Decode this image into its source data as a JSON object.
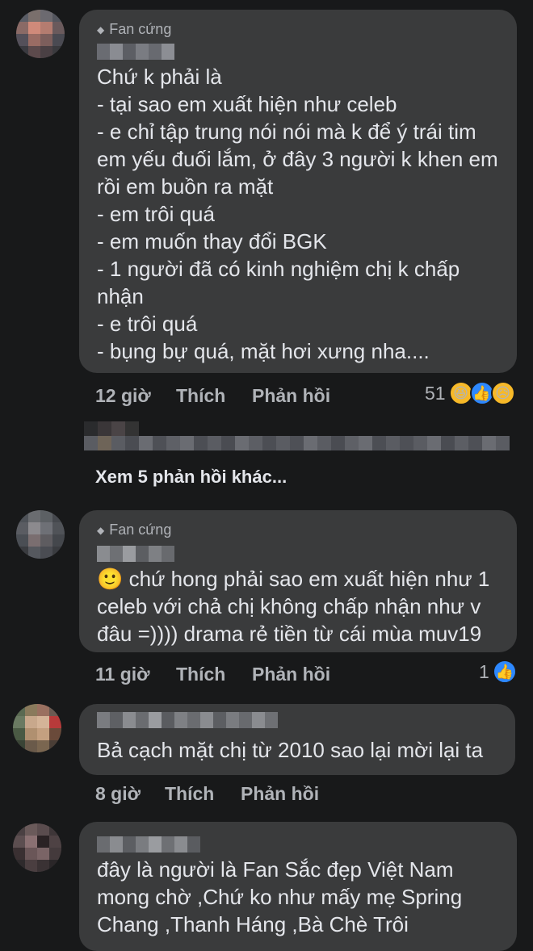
{
  "comments": [
    {
      "badge": "Fan cứng",
      "text": "Chứ k phải là\n- tại sao em xuất hiện như celeb\n- e chỉ tập trung nói nói mà k để ý trái tim em yếu đuối lắm, ở đây 3 người k khen em rồi em buồn ra mặt\n- em trôi quá\n- em muốn thay đổi BGK\n- 1 người đã có kinh nghiệm chị k chấp nhận\n- e trôi quá\n- bụng bự quá, mặt hơi xưng nha....",
      "time": "12 giờ",
      "like": "Thích",
      "reply": "Phản hồi",
      "reaction_count": "51",
      "reactions": [
        "haha-icon",
        "like-icon",
        "sad-icon"
      ]
    },
    {
      "badge": "Fan cứng",
      "text": "🙂 chứ hong phải sao em xuất hiện như 1 celeb với chả chị không chấp nhận như v đâu =)))) drama rẻ tiền từ cái mùa muv19",
      "time": "11 giờ",
      "like": "Thích",
      "reply": "Phản hồi",
      "reaction_count": "1",
      "reactions": [
        "like-icon"
      ]
    },
    {
      "text": "Bả cạch mặt chị từ 2010 sao lại mời lại ta",
      "time": "8 giờ",
      "like": "Thích",
      "reply": "Phản hồi"
    },
    {
      "text": "đây là người là Fan Sắc đẹp Việt Nam mong chờ ,Chứ ko như mấy mẹ Spring Chang ,Thanh Háng ,Bà Chè Trôi"
    }
  ],
  "view_more": "Xem 5 phản hồi khác...",
  "colors": {
    "bg": "#18191a",
    "bubble": "#3a3b3c",
    "text": "#e4e6eb",
    "muted": "#b0b3b8",
    "like": "#2d88ff",
    "haha": "#f7b928"
  }
}
